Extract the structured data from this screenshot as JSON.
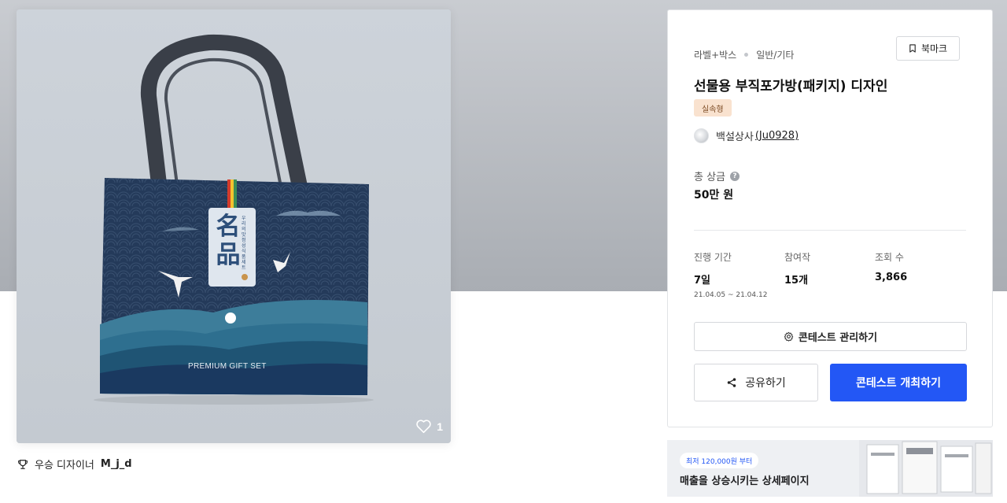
{
  "hero": {
    "like_count": "1",
    "bag_text": {
      "big_chars": "名品",
      "side_text": "우리의맛 정성식품세트",
      "premium": "PREMIUM GIFT SET"
    }
  },
  "winner": {
    "prefix": "우승 디자이너",
    "name": "M_j_d"
  },
  "panel": {
    "breadcrumb": [
      "라벨+박스",
      "일반/기타"
    ],
    "bookmark_label": "북마크",
    "title": "선물용 부직포가방(패키지) 디자인",
    "badge": "실속형",
    "host_name": "백설상사",
    "host_id": "(Ju0928)",
    "prize_label": "총 상금",
    "prize_value": "50만 원",
    "stats": [
      {
        "label": "진행 기간",
        "value": "7일",
        "sub": "21.04.05 ~ 21.04.12"
      },
      {
        "label": "참여작",
        "value": "15개",
        "sub": ""
      },
      {
        "label": "조회 수",
        "value": "3,866",
        "sub": ""
      }
    ],
    "manage_label": "콘테스트 관리하기",
    "share_label": "공유하기",
    "host_contest_label": "콘테스트 개최하기"
  },
  "ad": {
    "tag": "최저 120,000원 부터",
    "text": "매출을 상승시키는 상세페이지"
  },
  "colors": {
    "primary": "#2357f5",
    "badge_bg": "#f9e2cf",
    "bag_navy": "#243a5a"
  },
  "icons": [
    "heart-icon",
    "trophy-icon",
    "bookmark-icon",
    "help-icon",
    "gear-icon",
    "share-icon"
  ]
}
